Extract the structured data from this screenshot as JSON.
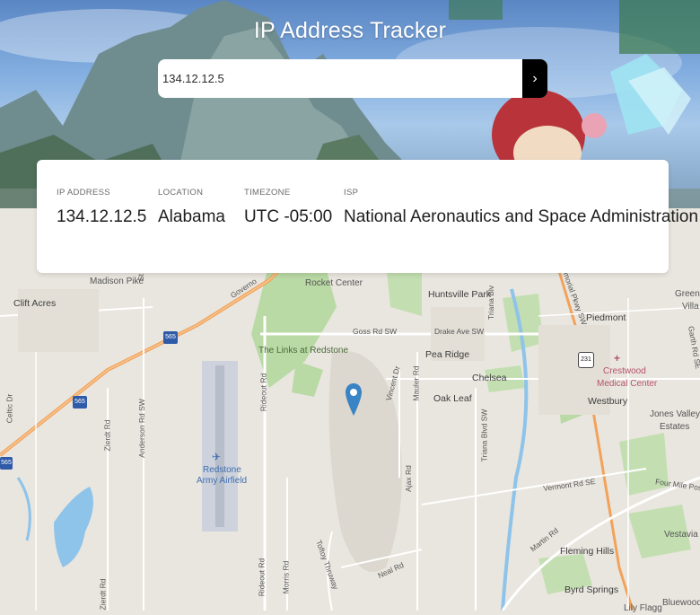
{
  "header": {
    "title": "IP Address Tracker"
  },
  "search": {
    "value": "134.12.12.5",
    "button_icon": "chevron-right-icon"
  },
  "info": {
    "ip_label": "IP ADDRESS",
    "ip_value": "134.12.12.5",
    "location_label": "LOCATION",
    "location_value": "Alabama",
    "timezone_label": "TIMEZONE",
    "timezone_value": "UTC -05:00",
    "isp_label": "ISP",
    "isp_value": "National Aeronautics and Space Administration"
  },
  "map": {
    "places": {
      "madison_pike": "Madison Pike",
      "clift_acres": "Clift Acres",
      "governors": "Governo",
      "rocket_center": "Rocket Center",
      "huntsville_park": "Huntsville Park",
      "piedmont": "Piedmont",
      "green": "Green",
      "villa": "Villa",
      "links": "The Links at Redstone",
      "pea_ridge": "Pea Ridge",
      "chelsea": "Chelsea",
      "crestwood": "Crestwood",
      "medical_center": "Medical Center",
      "oak_leaf": "Oak Leaf",
      "westbury": "Westbury",
      "jones_valley": "Jones Valley",
      "estates": "Estates",
      "redstone": "Redstone",
      "army_airfield": "Army Airfield",
      "fleming_hills": "Fleming Hills",
      "byrd_springs": "Byrd Springs",
      "vestavia": "Vestavia B",
      "blue_flag": "Lily Flagg",
      "bluewood": "Bluewood"
    },
    "roads": {
      "goss": "Goss Rd SW",
      "drake": "Drake Ave SW",
      "vermont": "Vermont Rd SE",
      "four_mile": "Four Mile Post",
      "martin": "Martin Rd",
      "neal": "Neal Rd",
      "ajax": "Ajax Rd",
      "mauler": "Mauler Rd",
      "vincent": "Vincent Dr",
      "triana_blvd": "Triana Blvd SW",
      "triana": "Triana Blv",
      "rideout": "Rideout Rd",
      "rideout2": "Rideout Rd",
      "morris": "Morris Rd",
      "toftoy": "Toftoy Thruway",
      "anderson": "Anderson Rd SW",
      "zierdt": "Zierdt Rd",
      "zierdt2": "Zierdt Rd",
      "celtic": "Celtic Dr",
      "memorial": "Memorial Pkwy SW",
      "garth": "Garth Rd SE",
      "st": "St"
    },
    "shields": {
      "i565a": "565",
      "i565b": "565",
      "i565c": "565",
      "us231": "231"
    }
  }
}
